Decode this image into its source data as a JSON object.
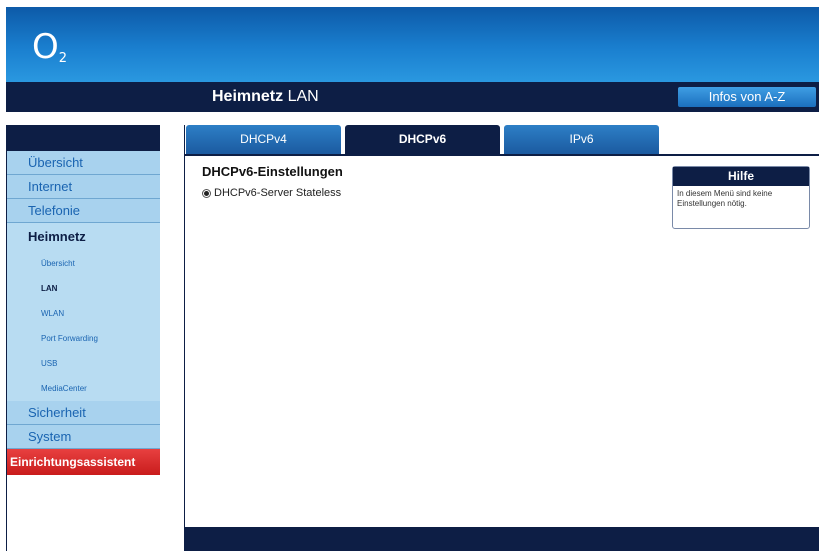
{
  "brand": {
    "logo_main": "O",
    "logo_sub": "2"
  },
  "header": {
    "section": "Heimnetz",
    "page": "LAN",
    "infos_button": "Infos von A-Z"
  },
  "tabs": [
    {
      "label": "DHCPv4",
      "active": false
    },
    {
      "label": "DHCPv6",
      "active": true
    },
    {
      "label": "IPv6",
      "active": false
    }
  ],
  "sidebar": {
    "items_top": [
      "Übersicht",
      "Internet",
      "Telefonie"
    ],
    "active_section": "Heimnetz",
    "subitems": [
      "Übersicht",
      "LAN",
      "WLAN",
      "Port Forwarding",
      "USB",
      "MediaCenter"
    ],
    "active_subitem": "LAN",
    "items_bottom": [
      "Sicherheit",
      "System"
    ],
    "wizard": "Einrichtungsassistent"
  },
  "content": {
    "section_title": "DHCPv6-Einstellungen",
    "radio_label": "DHCPv6-Server Stateless",
    "radio_selected": true
  },
  "help": {
    "title": "Hilfe",
    "text": "In diesem Menü sind keine Einstellungen nötig."
  },
  "colors": {
    "navy": "#0d1e45",
    "blue": "#1a7fcf",
    "sidebar": "#a8d2ee",
    "wizard_red": "#d42a2a"
  }
}
